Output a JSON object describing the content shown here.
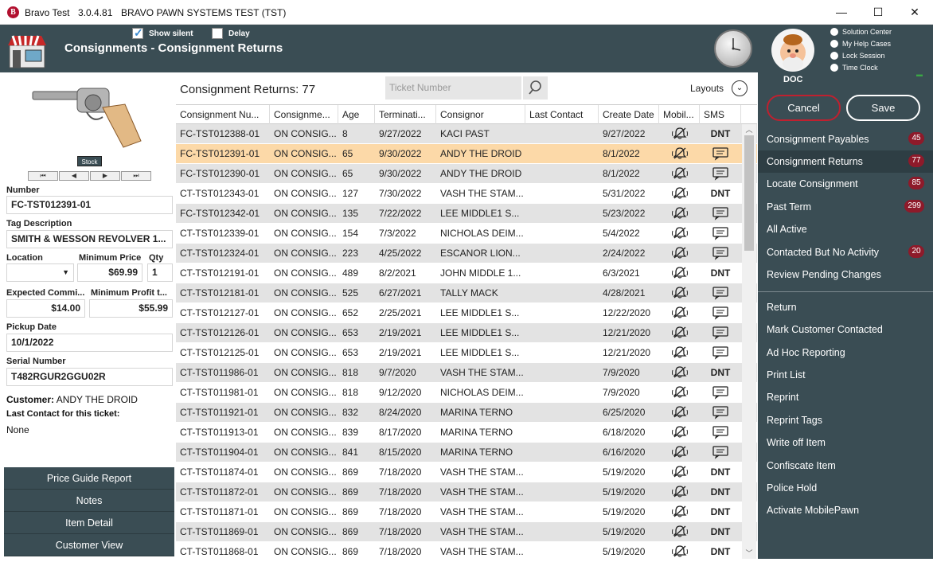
{
  "window": {
    "app_name": "Bravo Test",
    "version": "3.0.4.81",
    "system_title": "BRAVO PAWN SYSTEMS TEST (TST)",
    "logo_letter": "B",
    "minimize": "—",
    "maximize": "☐",
    "close": "✕"
  },
  "header": {
    "show_silent_label": "Show silent",
    "show_silent_checked": true,
    "delay_label": "Delay",
    "delay_checked": false,
    "page_title": "Consignments - Consignment Returns"
  },
  "user": {
    "name": "DOC",
    "links": [
      "Solution Center",
      "My Help Cases",
      "Lock Session",
      "Time Clock"
    ]
  },
  "actions": {
    "cancel": "Cancel",
    "save": "Save"
  },
  "nav": {
    "primary": [
      {
        "label": "Consignment Payables",
        "badge": "45",
        "active": false
      },
      {
        "label": "Consignment Returns",
        "badge": "77",
        "active": true
      },
      {
        "label": "Locate Consignment",
        "badge": "85",
        "active": false
      },
      {
        "label": "Past Term",
        "badge": "299",
        "active": false
      },
      {
        "label": "All Active",
        "badge": "",
        "active": false
      },
      {
        "label": "Contacted But No Activity",
        "badge": "20",
        "active": false
      },
      {
        "label": "Review Pending Changes",
        "badge": "",
        "active": false
      }
    ],
    "secondary": [
      "Return",
      "Mark Customer Contacted",
      "Ad Hoc Reporting",
      "Print List",
      "Reprint",
      "Reprint Tags",
      "Write off Item",
      "Confiscate Item",
      "Police Hold",
      "Activate MobilePawn"
    ]
  },
  "detail": {
    "stock_label": "Stock",
    "pager": [
      "⏮",
      "◀",
      "▶",
      "⏭"
    ],
    "number_label": "Number",
    "number": "FC-TST012391-01",
    "tag_label": "Tag Description",
    "tag": "SMITH & WESSON REVOLVER 1...",
    "location_label": "Location",
    "location": "",
    "min_price_label": "Minimum Price",
    "min_price": "$69.99",
    "qty_label": "Qty",
    "qty": "1",
    "exp_comm_label": "Expected Commi...",
    "exp_comm": "$14.00",
    "min_profit_label": "Minimum Profit t...",
    "min_profit": "$55.99",
    "pickup_label": "Pickup Date",
    "pickup": "10/1/2022",
    "serial_label": "Serial Number",
    "serial": "T482RGUR2GGU02R",
    "customer_label": "Customer:",
    "customer": "ANDY THE DROID",
    "last_contact_label": "Last Contact for this ticket:",
    "last_contact": "None"
  },
  "side_buttons": [
    "Price Guide Report",
    "Notes",
    "Item Detail",
    "Customer View"
  ],
  "list": {
    "title": "Consignment Returns: 77",
    "search_placeholder": "Ticket Number",
    "layouts_label": "Layouts",
    "columns": [
      "Consignment Nu...",
      "Consignme...",
      "Age",
      "Terminati...",
      "Consignor",
      "Last Contact",
      "Create Date",
      "Mobil...",
      "SMS"
    ],
    "rows": [
      {
        "num": "FC-TST012388-01",
        "status": "ON CONSIG...",
        "age": "8",
        "term": "9/27/2022",
        "consignor": "KACI PAST",
        "last": "",
        "create": "9/27/2022",
        "mobile": "bell-off",
        "sms": "DNT"
      },
      {
        "num": "FC-TST012391-01",
        "status": "ON CONSIG...",
        "age": "65",
        "term": "9/30/2022",
        "consignor": "ANDY THE DROID",
        "last": "",
        "create": "8/1/2022",
        "mobile": "bell-off",
        "sms": "msg"
      },
      {
        "num": "FC-TST012390-01",
        "status": "ON CONSIG...",
        "age": "65",
        "term": "9/30/2022",
        "consignor": "ANDY THE DROID",
        "last": "",
        "create": "8/1/2022",
        "mobile": "bell-off",
        "sms": "msg"
      },
      {
        "num": "CT-TST012343-01",
        "status": "ON CONSIG...",
        "age": "127",
        "term": "7/30/2022",
        "consignor": "VASH THE STAM...",
        "last": "",
        "create": "5/31/2022",
        "mobile": "bell-off",
        "sms": "DNT"
      },
      {
        "num": "FC-TST012342-01",
        "status": "ON CONSIG...",
        "age": "135",
        "term": "7/22/2022",
        "consignor": "LEE MIDDLE1 S...",
        "last": "",
        "create": "5/23/2022",
        "mobile": "bell-off",
        "sms": "msg"
      },
      {
        "num": "CT-TST012339-01",
        "status": "ON CONSIG...",
        "age": "154",
        "term": "7/3/2022",
        "consignor": "NICHOLAS DEIM...",
        "last": "",
        "create": "5/4/2022",
        "mobile": "bell-off",
        "sms": "msg"
      },
      {
        "num": "CT-TST012324-01",
        "status": "ON CONSIG...",
        "age": "223",
        "term": "4/25/2022",
        "consignor": "ESCANOR LION...",
        "last": "",
        "create": "2/24/2022",
        "mobile": "bell-off",
        "sms": "msg"
      },
      {
        "num": "CT-TST012191-01",
        "status": "ON CONSIG...",
        "age": "489",
        "term": "8/2/2021",
        "consignor": "JOHN MIDDLE 1...",
        "last": "",
        "create": "6/3/2021",
        "mobile": "bell-off",
        "sms": "DNT"
      },
      {
        "num": "CT-TST012181-01",
        "status": "ON CONSIG...",
        "age": "525",
        "term": "6/27/2021",
        "consignor": "TALLY MACK",
        "last": "",
        "create": "4/28/2021",
        "mobile": "bell-off",
        "sms": "msg"
      },
      {
        "num": "CT-TST012127-01",
        "status": "ON CONSIG...",
        "age": "652",
        "term": "2/25/2021",
        "consignor": "LEE MIDDLE1 S...",
        "last": "",
        "create": "12/22/2020",
        "mobile": "bell-off",
        "sms": "msg"
      },
      {
        "num": "CT-TST012126-01",
        "status": "ON CONSIG...",
        "age": "653",
        "term": "2/19/2021",
        "consignor": "LEE MIDDLE1 S...",
        "last": "",
        "create": "12/21/2020",
        "mobile": "bell-off",
        "sms": "msg"
      },
      {
        "num": "CT-TST012125-01",
        "status": "ON CONSIG...",
        "age": "653",
        "term": "2/19/2021",
        "consignor": "LEE MIDDLE1 S...",
        "last": "",
        "create": "12/21/2020",
        "mobile": "bell-off",
        "sms": "msg"
      },
      {
        "num": "CT-TST011986-01",
        "status": "ON CONSIG...",
        "age": "818",
        "term": "9/7/2020",
        "consignor": "VASH THE STAM...",
        "last": "",
        "create": "7/9/2020",
        "mobile": "bell-off",
        "sms": "DNT"
      },
      {
        "num": "CT-TST011981-01",
        "status": "ON CONSIG...",
        "age": "818",
        "term": "9/12/2020",
        "consignor": "NICHOLAS DEIM...",
        "last": "",
        "create": "7/9/2020",
        "mobile": "bell-off",
        "sms": "msg"
      },
      {
        "num": "CT-TST011921-01",
        "status": "ON CONSIG...",
        "age": "832",
        "term": "8/24/2020",
        "consignor": "MARINA TERNO",
        "last": "",
        "create": "6/25/2020",
        "mobile": "bell-off",
        "sms": "msg"
      },
      {
        "num": "CT-TST011913-01",
        "status": "ON CONSIG...",
        "age": "839",
        "term": "8/17/2020",
        "consignor": "MARINA TERNO",
        "last": "",
        "create": "6/18/2020",
        "mobile": "bell-off",
        "sms": "msg"
      },
      {
        "num": "CT-TST011904-01",
        "status": "ON CONSIG...",
        "age": "841",
        "term": "8/15/2020",
        "consignor": "MARINA TERNO",
        "last": "",
        "create": "6/16/2020",
        "mobile": "bell-off",
        "sms": "msg"
      },
      {
        "num": "CT-TST011874-01",
        "status": "ON CONSIG...",
        "age": "869",
        "term": "7/18/2020",
        "consignor": "VASH THE STAM...",
        "last": "",
        "create": "5/19/2020",
        "mobile": "bell-off",
        "sms": "DNT"
      },
      {
        "num": "CT-TST011872-01",
        "status": "ON CONSIG...",
        "age": "869",
        "term": "7/18/2020",
        "consignor": "VASH THE STAM...",
        "last": "",
        "create": "5/19/2020",
        "mobile": "bell-off",
        "sms": "DNT"
      },
      {
        "num": "CT-TST011871-01",
        "status": "ON CONSIG...",
        "age": "869",
        "term": "7/18/2020",
        "consignor": "VASH THE STAM...",
        "last": "",
        "create": "5/19/2020",
        "mobile": "bell-off",
        "sms": "DNT"
      },
      {
        "num": "CT-TST011869-01",
        "status": "ON CONSIG...",
        "age": "869",
        "term": "7/18/2020",
        "consignor": "VASH THE STAM...",
        "last": "",
        "create": "5/19/2020",
        "mobile": "bell-off",
        "sms": "DNT"
      },
      {
        "num": "CT-TST011868-01",
        "status": "ON CONSIG...",
        "age": "869",
        "term": "7/18/2020",
        "consignor": "VASH THE STAM...",
        "last": "",
        "create": "5/19/2020",
        "mobile": "bell-off",
        "sms": "DNT"
      }
    ],
    "selected_index": 1
  },
  "colors": {
    "panel": "#3a4d54",
    "selected_row": "#fcd9a8",
    "alt_row": "#e3e3e3",
    "badge": "#8e1a2a",
    "cancel_border": "#c0202f"
  },
  "icons": {
    "mobile": "bell-off-icon",
    "sms": "message-icon",
    "search": "search-icon",
    "layouts": "chevron-down-icon",
    "clock": "clock-icon",
    "store": "store-icon"
  }
}
